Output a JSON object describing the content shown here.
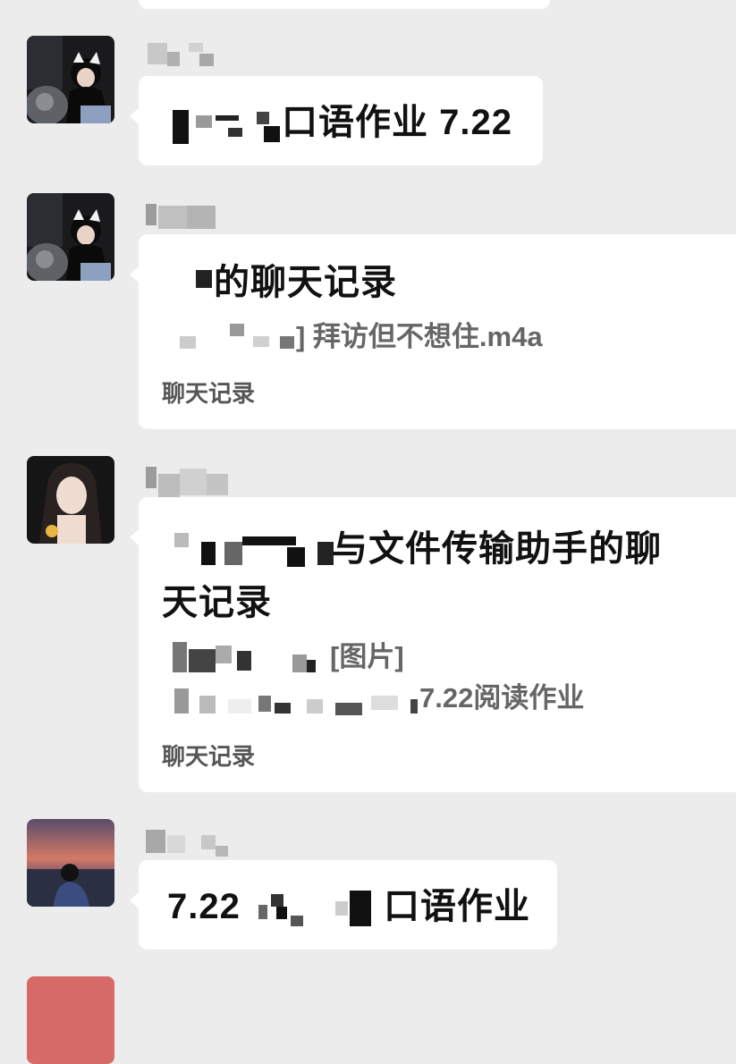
{
  "messages": [
    {
      "type": "text",
      "text": "口语作业 7.22"
    },
    {
      "type": "chat_record",
      "title": "的聊天记录",
      "lines": [
        "] 拜访但不想住.m4a"
      ],
      "footer": "聊天记录"
    },
    {
      "type": "chat_record",
      "title_line1": "与文件传输助手的聊",
      "title_line2": "天记录",
      "lines": [
        "[图片]",
        "7.22阅读作业"
      ],
      "footer": "聊天记录"
    },
    {
      "type": "text",
      "prefix": "7.22",
      "text": "口语作业"
    }
  ],
  "colors": {
    "background": "#ececec",
    "bubble": "#ffffff",
    "text": "#111111",
    "subtext": "#666666"
  },
  "icons": [
    "avatar-girl-cat",
    "avatar-girl-cat",
    "avatar-girl-portrait",
    "avatar-sunset-man"
  ]
}
